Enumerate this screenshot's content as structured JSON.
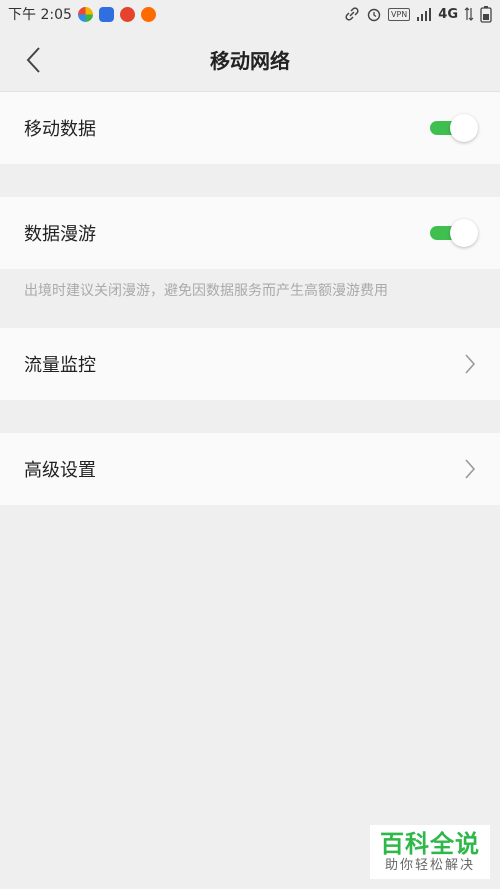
{
  "status_bar": {
    "time": "下午 2:05",
    "network": "4G"
  },
  "nav": {
    "title": "移动网络"
  },
  "settings": {
    "mobile_data": {
      "label": "移动数据",
      "enabled": true
    },
    "data_roaming": {
      "label": "数据漫游",
      "enabled": true
    },
    "roaming_hint": "出境时建议关闭漫游，避免因数据服务而产生高额漫游费用",
    "traffic_monitor": {
      "label": "流量监控"
    },
    "advanced_settings": {
      "label": "高级设置"
    }
  },
  "watermark": {
    "title": "百科全说",
    "subtitle": "助你轻松解决"
  },
  "colors": {
    "toggle_on": "#3fbf4f",
    "watermark_green": "#2eb84a",
    "background": "#efefef",
    "row_background": "#fafafa"
  }
}
